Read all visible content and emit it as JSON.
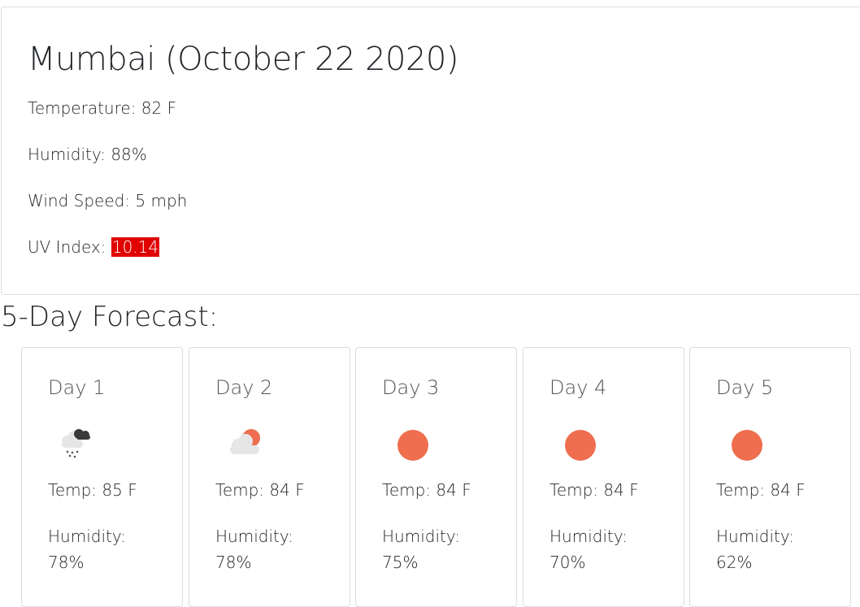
{
  "current": {
    "title": "Mumbai (October 22 2020)",
    "temperature_label": "Temperature:",
    "temperature_value": "82 F",
    "humidity_label": "Humidity:",
    "humidity_value": "88%",
    "wind_label": "Wind Speed:",
    "wind_value": "5 mph",
    "uv_label": "UV Index:",
    "uv_value": "10.14",
    "uv_color": "#e00000"
  },
  "forecast": {
    "title": "5-Day Forecast:",
    "days": [
      {
        "label": "Day 1",
        "icon": "rain-cloud-icon",
        "temp_label": "Temp:",
        "temp": "85 F",
        "humidity_label": "Humidity:",
        "humidity": "78%"
      },
      {
        "label": "Day 2",
        "icon": "partly-cloudy-icon",
        "temp_label": "Temp:",
        "temp": "84 F",
        "humidity_label": "Humidity:",
        "humidity": "78%"
      },
      {
        "label": "Day 3",
        "icon": "sun-icon",
        "temp_label": "Temp:",
        "temp": "84 F",
        "humidity_label": "Humidity:",
        "humidity": "75%"
      },
      {
        "label": "Day 4",
        "icon": "sun-icon",
        "temp_label": "Temp:",
        "temp": "84 F",
        "humidity_label": "Humidity:",
        "humidity": "70%"
      },
      {
        "label": "Day 5",
        "icon": "sun-icon",
        "temp_label": "Temp:",
        "temp": "84 F",
        "humidity_label": "Humidity:",
        "humidity": "62%"
      }
    ]
  },
  "colors": {
    "sun": "#ee6e4f",
    "cloud_light": "#e6e6e6",
    "cloud_dark": "#3a3a3a"
  }
}
